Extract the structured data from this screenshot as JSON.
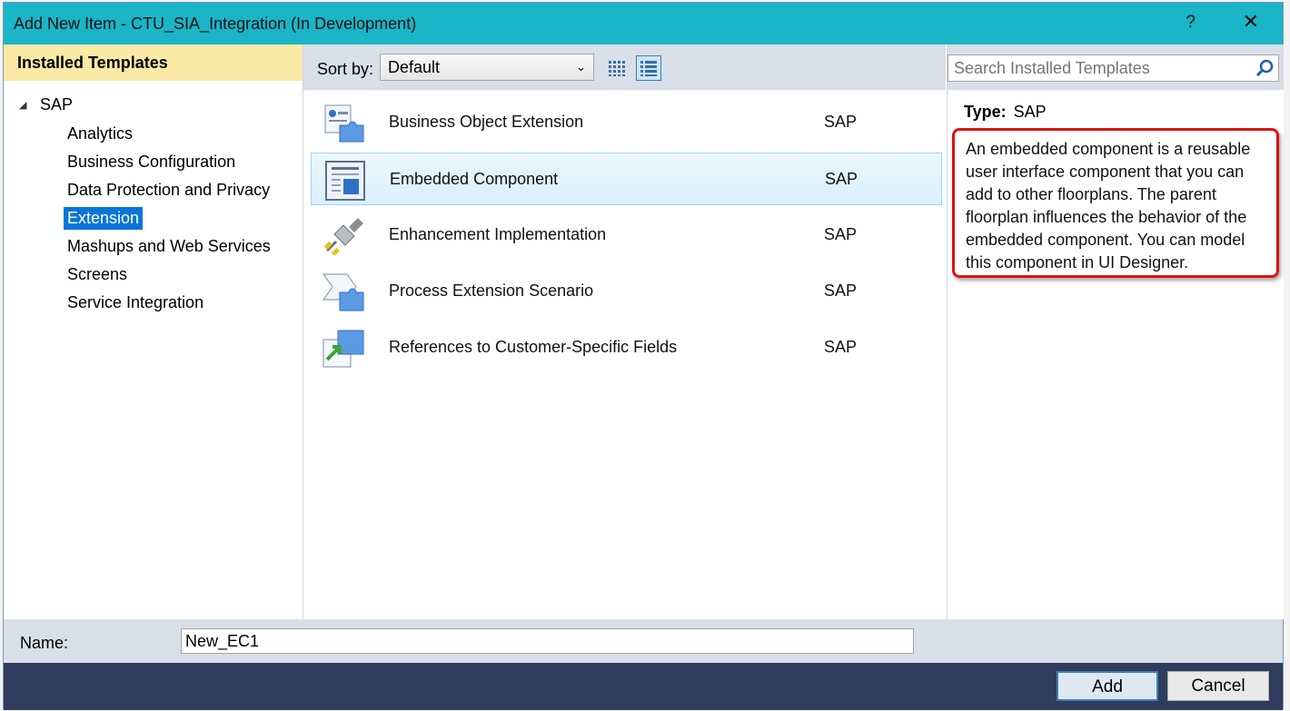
{
  "dialog": {
    "title": "Add New Item - CTU_SIA_Integration (In Development)",
    "help_label": "?",
    "close_label": "✕"
  },
  "left": {
    "header": "Installed Templates",
    "root": "SAP",
    "children": [
      "Analytics",
      "Business Configuration",
      "Data Protection and Privacy",
      "Extension",
      "Mashups and Web Services",
      "Screens",
      "Service Integration"
    ],
    "selected": "Extension"
  },
  "sortbar": {
    "label": "Sort by:",
    "value": "Default"
  },
  "items": [
    {
      "name": "Business Object Extension",
      "type": "SAP",
      "icon": "business-object-extension-icon"
    },
    {
      "name": "Embedded Component",
      "type": "SAP",
      "icon": "embedded-component-icon"
    },
    {
      "name": "Enhancement Implementation",
      "type": "SAP",
      "icon": "plug-icon"
    },
    {
      "name": "Process Extension Scenario",
      "type": "SAP",
      "icon": "process-extension-icon"
    },
    {
      "name": "References to Customer-Specific Fields",
      "type": "SAP",
      "icon": "field-reference-icon"
    }
  ],
  "selected_item": "Embedded Component",
  "search": {
    "placeholder": "Search Installed Templates"
  },
  "details": {
    "type_label": "Type:",
    "type_value": "SAP",
    "description": "An embedded component is a reusable user interface component that you can add to other floorplans. The parent floorplan influences the behavior of the embedded component. You can model this component in UI Designer."
  },
  "name_field": {
    "label": "Name:",
    "value": "New_EC1"
  },
  "buttons": {
    "add": "Add",
    "cancel": "Cancel"
  },
  "colors": {
    "titlebar": "#1ab5c6",
    "selection": "#0a75d8",
    "highlight_border": "#dd1111",
    "footer": "#2f3c5c"
  }
}
